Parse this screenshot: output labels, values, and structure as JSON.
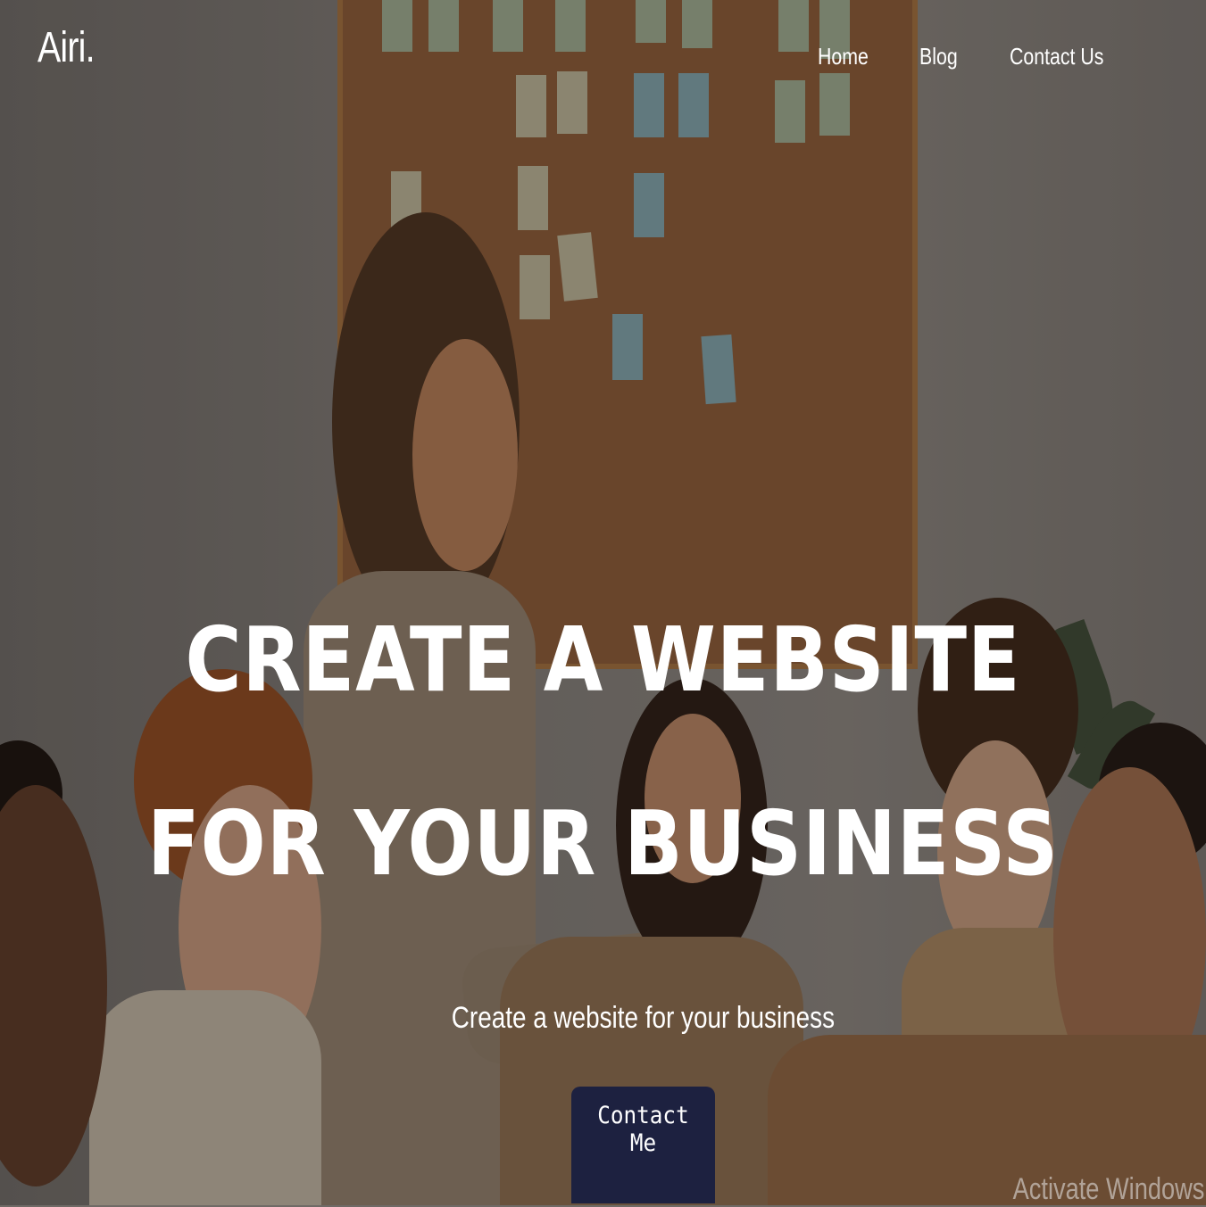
{
  "brand": {
    "logo": "Airi."
  },
  "nav": {
    "items": [
      {
        "label": "Home"
      },
      {
        "label": "Blog"
      },
      {
        "label": "Contact Us"
      }
    ]
  },
  "hero": {
    "title_line1": "CREATE A WEBSITE",
    "title_line2": "FOR YOUR BUSINESS",
    "subtitle": "Create a website for your business",
    "cta_label": "Contact Me"
  },
  "system": {
    "watermark": "Activate Windows"
  },
  "colors": {
    "cta_bg": "#1d2140",
    "text": "#ffffff"
  }
}
